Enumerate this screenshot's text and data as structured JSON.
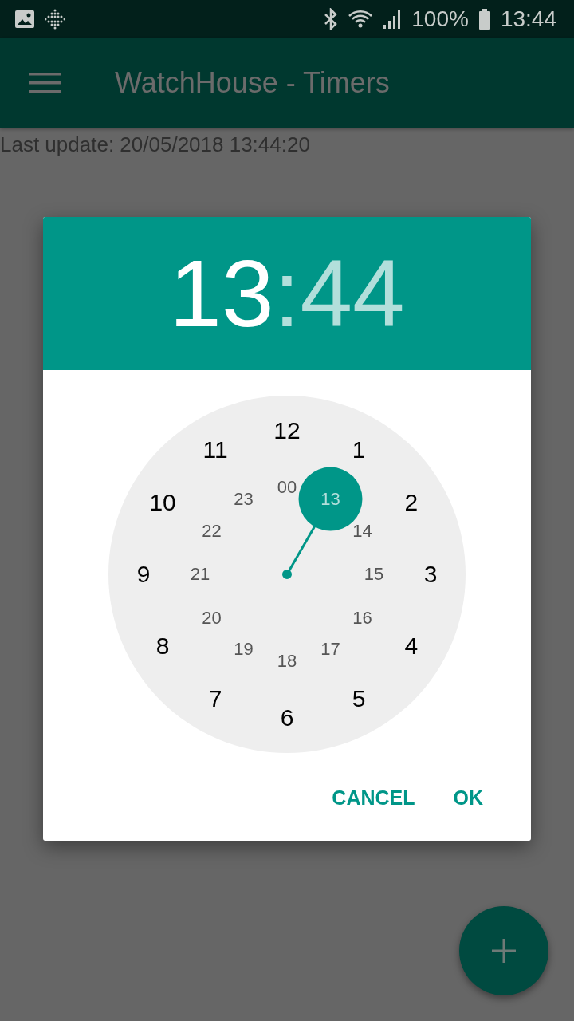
{
  "status_bar": {
    "battery": "100%",
    "time": "13:44"
  },
  "app_bar": {
    "title": "WatchHouse - Timers"
  },
  "last_update": "Last update: 20/05/2018 13:44:20",
  "dialog": {
    "time_fields": [
      {
        "text": "13",
        "selected": true
      },
      {
        "text": "44",
        "selected": false
      }
    ],
    "separator": ":",
    "clock": {
      "outer": [
        {
          "label": "12",
          "selected": false
        },
        {
          "label": "1",
          "selected": false
        },
        {
          "label": "2",
          "selected": false
        },
        {
          "label": "3",
          "selected": false
        },
        {
          "label": "4",
          "selected": false
        },
        {
          "label": "5",
          "selected": false
        },
        {
          "label": "6",
          "selected": false
        },
        {
          "label": "7",
          "selected": false
        },
        {
          "label": "8",
          "selected": false
        },
        {
          "label": "9",
          "selected": false
        },
        {
          "label": "10",
          "selected": false
        },
        {
          "label": "11",
          "selected": false
        }
      ],
      "inner": [
        {
          "label": "00",
          "selected": false
        },
        {
          "label": "13",
          "selected": true
        },
        {
          "label": "14",
          "selected": false
        },
        {
          "label": "15",
          "selected": false
        },
        {
          "label": "16",
          "selected": false
        },
        {
          "label": "17",
          "selected": false
        },
        {
          "label": "18",
          "selected": false
        },
        {
          "label": "19",
          "selected": false
        },
        {
          "label": "20",
          "selected": false
        },
        {
          "label": "21",
          "selected": false
        },
        {
          "label": "22",
          "selected": false
        },
        {
          "label": "23",
          "selected": false
        }
      ]
    },
    "buttons": [
      "CANCEL",
      "OK"
    ]
  }
}
